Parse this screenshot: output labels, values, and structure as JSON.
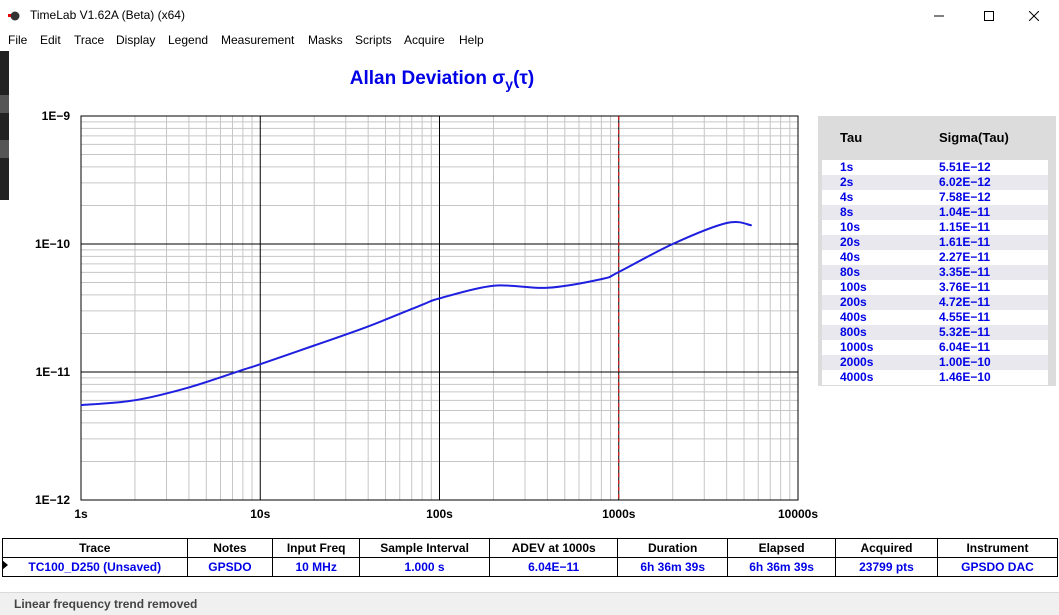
{
  "window": {
    "title": "TimeLab V1.62A (Beta) (x64)",
    "min_glyph": "—",
    "max_glyph": "☐",
    "close_glyph": "✕"
  },
  "menu": [
    "File",
    "Edit",
    "Trace",
    "Display",
    "Legend",
    "Measurement",
    "Masks",
    "Scripts",
    "Acquire",
    "Help"
  ],
  "chart_title": {
    "text": "Allan Deviation σ",
    "sub": "y",
    "suffix": "(τ)"
  },
  "chart_data": {
    "type": "line",
    "title": "Allan Deviation σy(τ)",
    "xscale": "log",
    "yscale": "log",
    "xlim": [
      1,
      10000
    ],
    "ylim": [
      1e-12,
      1e-09
    ],
    "x_tick_labels": [
      "1s",
      "10s",
      "100s",
      "1000s",
      "10000s"
    ],
    "y_tick_labels": [
      "1E−9",
      "1E−10",
      "1E−11",
      "1E−12"
    ],
    "grid": true,
    "marker_line": {
      "x": 1000,
      "style": "dashed",
      "color": "#e00000"
    },
    "series": [
      {
        "color": "#1f1fe0",
        "x": [
          1,
          2,
          4,
          8,
          10,
          20,
          40,
          80,
          100,
          200,
          400,
          800,
          1000,
          2000,
          4000,
          5500
        ],
        "y": [
          5.51e-12,
          6.02e-12,
          7.58e-12,
          1.04e-11,
          1.15e-11,
          1.61e-11,
          2.27e-11,
          3.35e-11,
          3.76e-11,
          4.72e-11,
          4.55e-11,
          5.32e-11,
          6.04e-11,
          1e-10,
          1.46e-10,
          1.4e-10
        ]
      }
    ]
  },
  "side_table": {
    "headers": {
      "tau": "Tau",
      "sigma": "Sigma(Tau)"
    },
    "rows": [
      {
        "tau": "1s",
        "sigma": "5.51E−12"
      },
      {
        "tau": "2s",
        "sigma": "6.02E−12"
      },
      {
        "tau": "4s",
        "sigma": "7.58E−12"
      },
      {
        "tau": "8s",
        "sigma": "1.04E−11"
      },
      {
        "tau": "10s",
        "sigma": "1.15E−11"
      },
      {
        "tau": "20s",
        "sigma": "1.61E−11"
      },
      {
        "tau": "40s",
        "sigma": "2.27E−11"
      },
      {
        "tau": "80s",
        "sigma": "3.35E−11"
      },
      {
        "tau": "100s",
        "sigma": "3.76E−11"
      },
      {
        "tau": "200s",
        "sigma": "4.72E−11"
      },
      {
        "tau": "400s",
        "sigma": "4.55E−11"
      },
      {
        "tau": "800s",
        "sigma": "5.32E−11"
      },
      {
        "tau": "1000s",
        "sigma": "6.04E−11"
      },
      {
        "tau": "2000s",
        "sigma": "1.00E−10"
      },
      {
        "tau": "4000s",
        "sigma": "1.46E−10"
      }
    ]
  },
  "info": {
    "headers": {
      "trace": "Trace",
      "notes": "Notes",
      "input_freq": "Input Freq",
      "sample_interval": "Sample Interval",
      "adev": "ADEV at 1000s",
      "duration": "Duration",
      "elapsed": "Elapsed",
      "acquired": "Acquired",
      "instrument": "Instrument"
    },
    "values": {
      "trace": "TC100_D250 (Unsaved)",
      "notes": "GPSDO",
      "input_freq": "10 MHz",
      "sample_interval": "1.000 s",
      "adev": "6.04E−11",
      "duration": "6h 36m 39s",
      "elapsed": "6h 36m 39s",
      "acquired": "23799 pts",
      "instrument": "GPSDO DAC"
    }
  },
  "status": "Linear frequency trend removed",
  "colors": {
    "title": "#0000e6",
    "trace": "#1f1fe0",
    "adev_header": "#e00000",
    "table_bg": "#dcdcdc"
  }
}
